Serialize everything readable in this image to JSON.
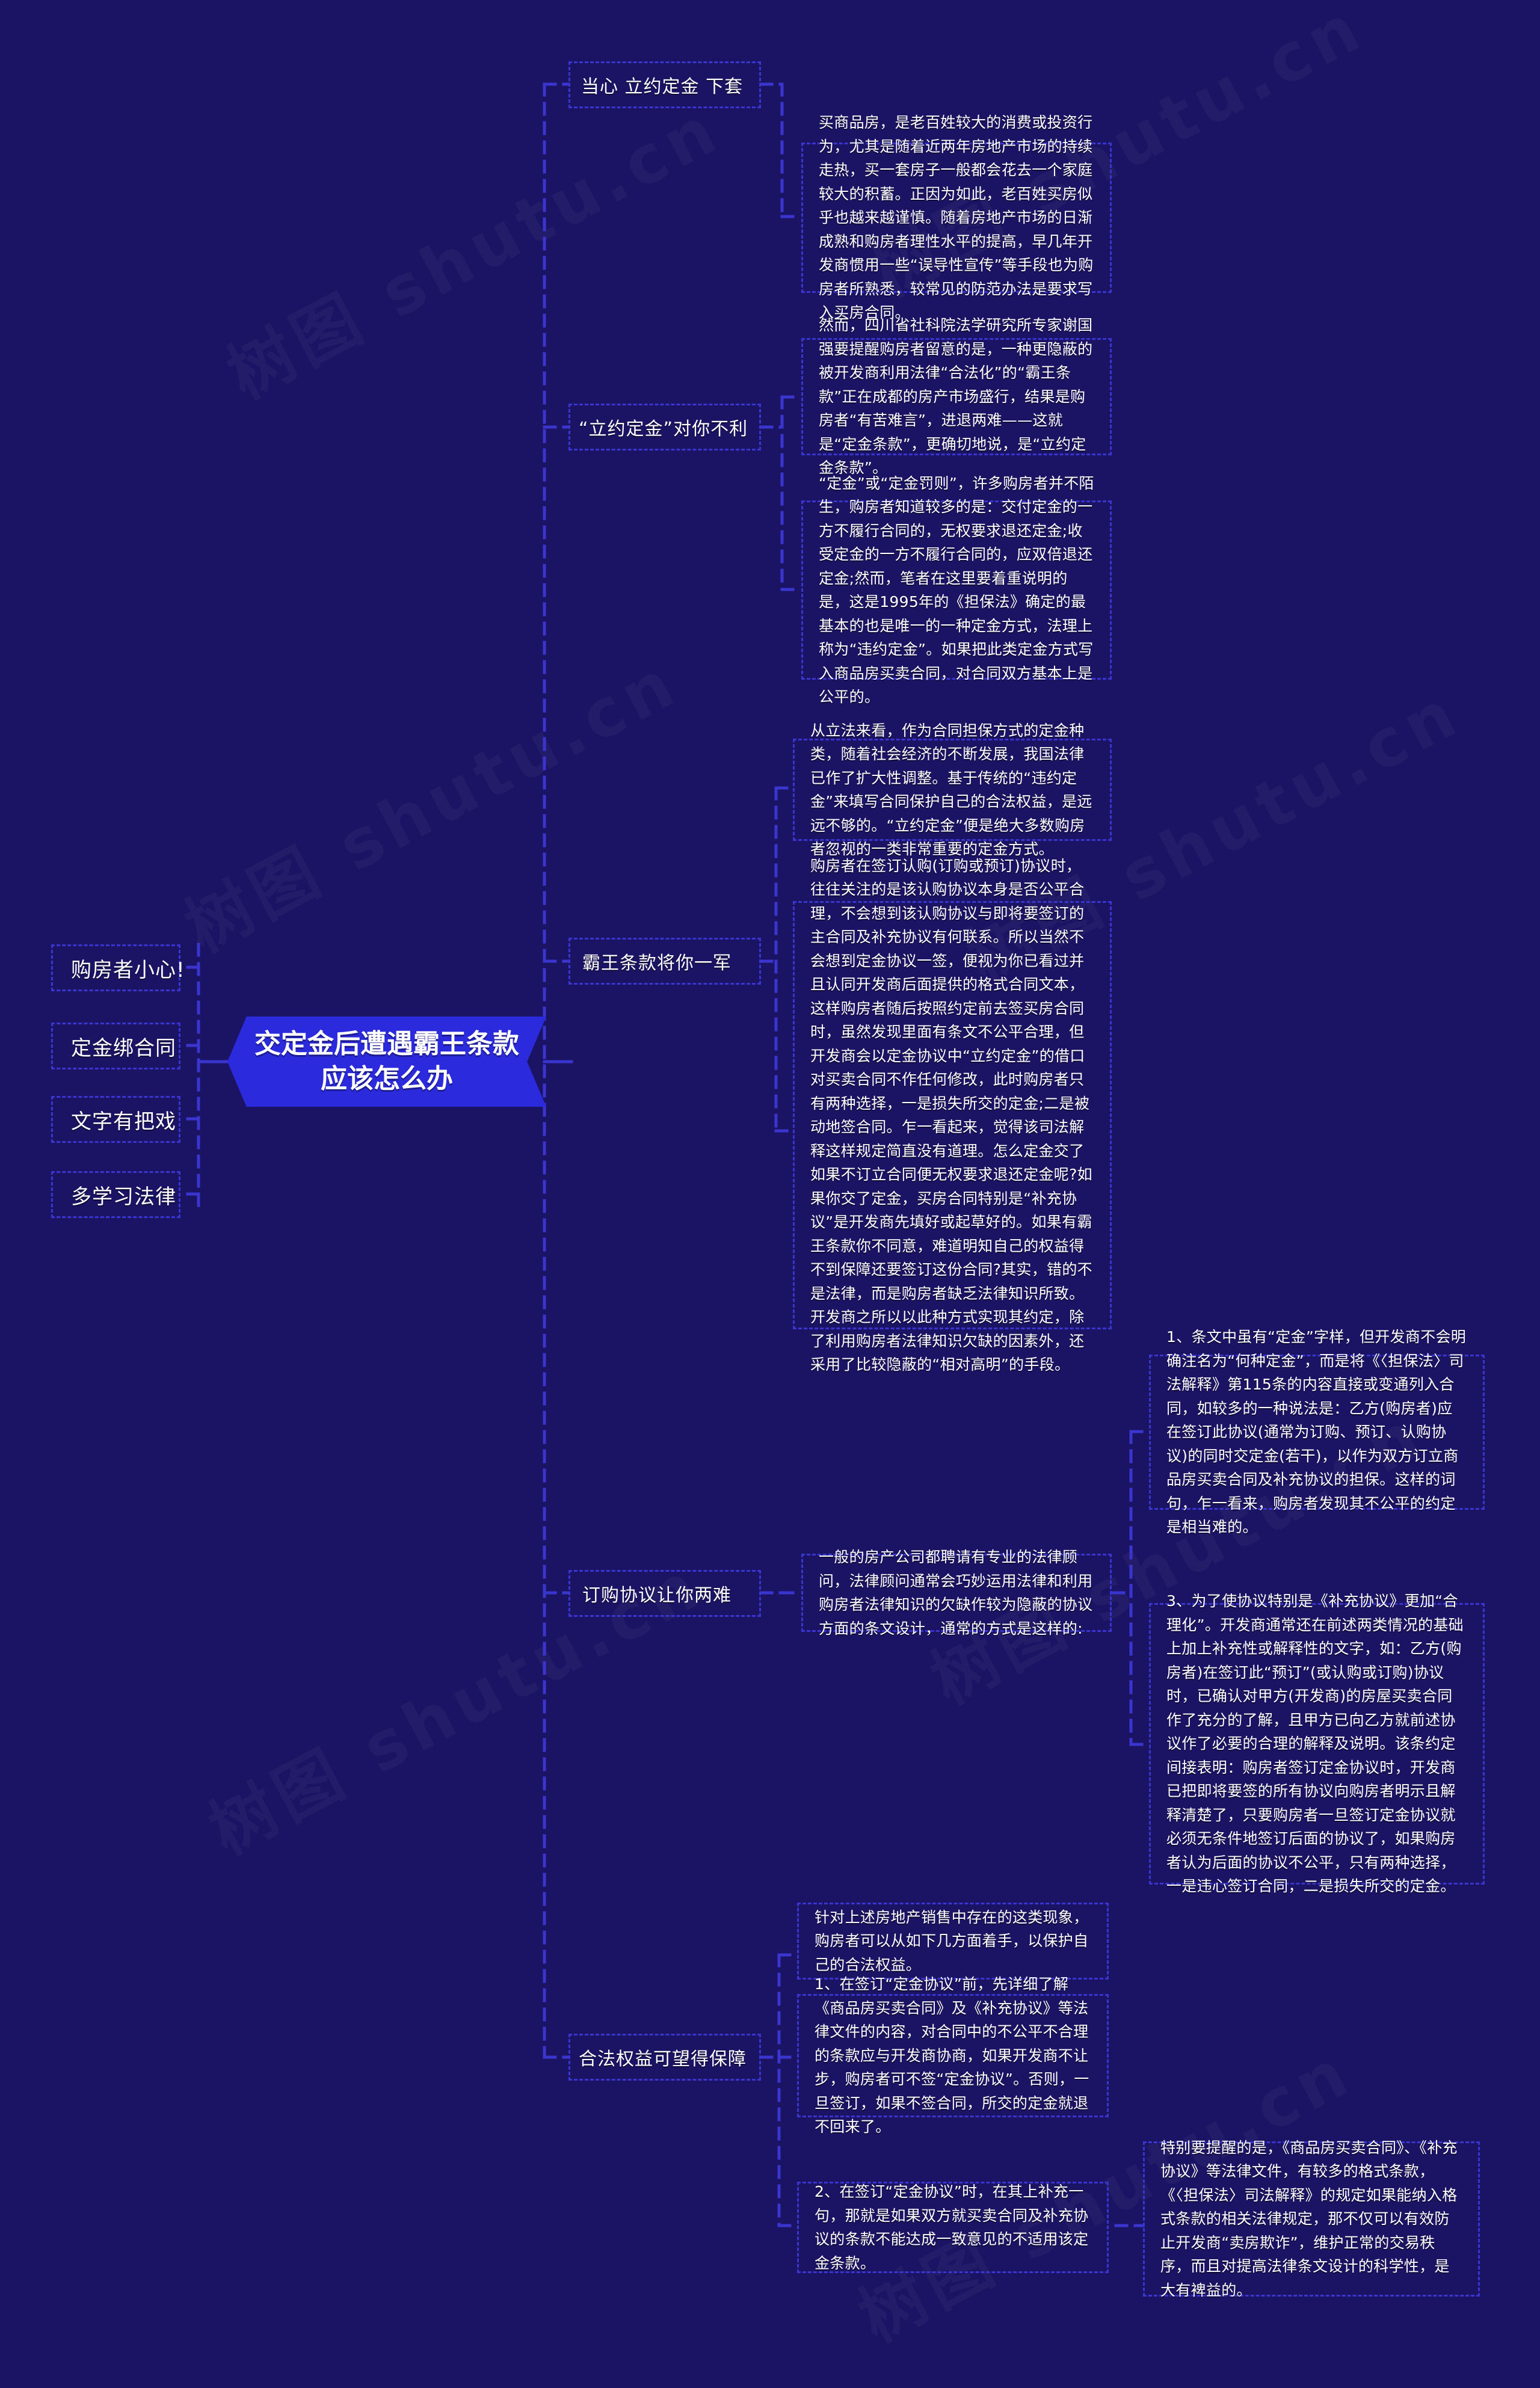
{
  "root": {
    "title": "交定金后遭遇霸王条款应该怎么办",
    "color": "#2b2bdd"
  },
  "theme": {
    "background": "#1b1464",
    "node_border": "#3b35cf",
    "text": "#ffffff"
  },
  "watermark": "树图 shutu.cn",
  "left_branches": [
    {
      "label": "购房者小心!"
    },
    {
      "label": "定金绑合同"
    },
    {
      "label": "文字有把戏"
    },
    {
      "label": "多学习法律"
    }
  ],
  "right_branches": [
    {
      "label": "当心 立约定金 下套",
      "children": [
        {
          "text": "买商品房，是老百姓较大的消费或投资行为，尤其是随着近两年房地产市场的持续走热，买一套房子一般都会花去一个家庭较大的积蓄。正因为如此，老百姓买房似乎也越来越谨慎。随着房地产市场的日渐成熟和购房者理性水平的提高，早几年开发商惯用一些“误导性宣传”等手段也为购房者所熟悉，较常见的防范办法是要求写入买房合同。"
        }
      ]
    },
    {
      "label": "“立约定金”对你不利",
      "children": [
        {
          "text": "然而，四川省社科院法学研究所专家谢国强要提醒购房者留意的是，一种更隐蔽的被开发商利用法律“合法化”的“霸王条款”正在成都的房产市场盛行，结果是购房者“有苦难言”，进退两难——这就是“定金条款”，更确切地说，是“立约定金条款”。"
        },
        {
          "text": "“定金”或“定金罚则”，许多购房者并不陌生，购房者知道较多的是：交付定金的一方不履行合同的，无权要求退还定金;收受定金的一方不履行合同的，应双倍退还定金;然而，笔者在这里要着重说明的是，这是1995年的《担保法》确定的最基本的也是唯一的一种定金方式，法理上称为“违约定金”。如果把此类定金方式写入商品房买卖合同，对合同双方基本上是公平的。"
        }
      ]
    },
    {
      "label": "霸王条款将你一军",
      "children": [
        {
          "text": "从立法来看，作为合同担保方式的定金种类，随着社会经济的不断发展，我国法律已作了扩大性调整。基于传统的“违约定金”来填写合同保护自己的合法权益，是远远不够的。“立约定金”便是绝大多数购房者忽视的一类非常重要的定金方式。"
        },
        {
          "text": "购房者在签订认购(订购或预订)协议时，往往关注的是该认购协议本身是否公平合理，不会想到该认购协议与即将要签订的主合同及补充协议有何联系。所以当然不会想到定金协议一签，便视为你已看过并且认同开发商后面提供的格式合同文本，这样购房者随后按照约定前去签买房合同时，虽然发现里面有条文不公平合理，但开发商会以定金协议中“立约定金”的借口对买卖合同不作任何修改，此时购房者只有两种选择，一是损失所交的定金;二是被动地签合同。乍一看起来，觉得该司法解释这样规定简直没有道理。怎么定金交了如果不订立合同便无权要求退还定金呢?如果你交了定金，买房合同特别是“补充协议”是开发商先填好或起草好的。如果有霸王条款你不同意，难道明知自己的权益得不到保障还要签订这份合同?其实，错的不是法律，而是购房者缺乏法律知识所致。开发商之所以以此种方式实现其约定，除了利用购房者法律知识欠缺的因素外，还采用了比较隐蔽的“相对高明”的手段。"
        }
      ]
    },
    {
      "label": "订购协议让你两难",
      "children": [
        {
          "text": "一般的房产公司都聘请有专业的法律顾问，法律顾问通常会巧妙运用法律和利用购房者法律知识的欠缺作较为隐蔽的协议方面的条文设计，通常的方式是这样的:",
          "children": [
            {
              "text": "1、条文中虽有“定金”字样，但开发商不会明确注名为“何种定金”，而是将《〈担保法〉司法解释》第115条的内容直接或变通列入合同，如较多的一种说法是：乙方(购房者)应在签订此协议(通常为订购、预订、认购协议)的同时交定金(若干)，以作为双方订立商品房买卖合同及补充协议的担保。这样的词句，乍一看来，购房者发现其不公平的约定是相当难的。"
            },
            {
              "text": "3、为了使协议特别是《补充协议》更加“合理化”。开发商通常还在前述两类情况的基础上加上补充性或解释性的文字，如：乙方(购房者)在签订此“预订”(或认购或订购)协议时，已确认对甲方(开发商)的房屋买卖合同作了充分的了解，且甲方已向乙方就前述协议作了必要的合理的解释及说明。该条约定间接表明：购房者签订定金协议时，开发商已把即将要签的所有协议向购房者明示且解释清楚了，只要购房者一旦签订定金协议就必须无条件地签订后面的协议了，如果购房者认为后面的协议不公平，只有两种选择，一是违心签订合同，二是损失所交的定金。"
            }
          ]
        }
      ]
    },
    {
      "label": "合法权益可望得保障",
      "children": [
        {
          "text": "针对上述房地产销售中存在的这类现象，购房者可以从如下几方面着手，以保护自己的合法权益。"
        },
        {
          "text": "1、在签订“定金协议”前，先详细了解《商品房买卖合同》及《补充协议》等法律文件的内容，对合同中的不公平不合理的条款应与开发商协商，如果开发商不让步，购房者可不签“定金协议”。否则，一旦签订，如果不签合同，所交的定金就退不回来了。"
        },
        {
          "text": "2、在签订“定金协议”时，在其上补充一句，那就是如果双方就买卖合同及补充协议的条款不能达成一致意见的不适用该定金条款。",
          "children": [
            {
              "text": "特别要提醒的是，《商品房买卖合同》、《补充协议》等法律文件，有较多的格式条款，《〈担保法〉司法解释》的规定如果能纳入格式条款的相关法律规定，那不仅可以有效防止开发商“卖房欺诈”，维护正常的交易秩序，而且对提高法律条文设计的科学性，是大有裨益的。"
            }
          ]
        }
      ]
    }
  ]
}
